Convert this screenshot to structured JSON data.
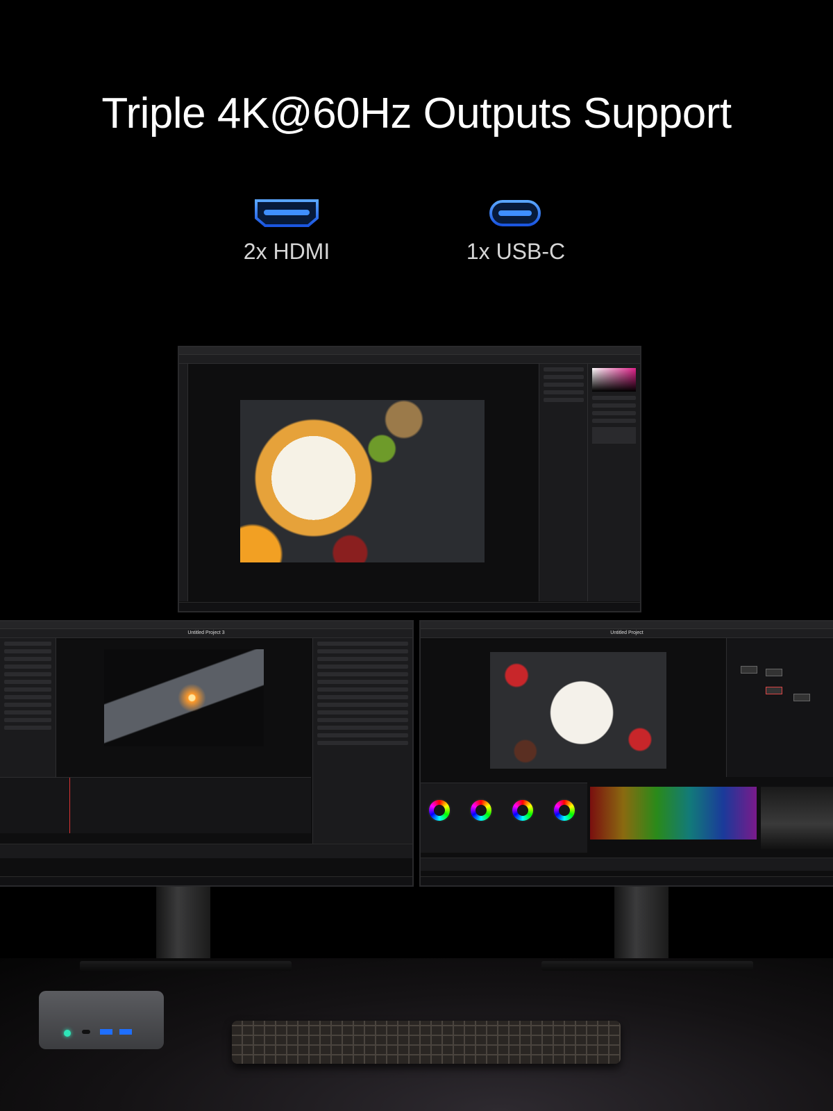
{
  "headline": "Triple 4K@60Hz Outputs Support",
  "ports": [
    {
      "icon": "hdmi-port-icon",
      "label": "2x HDMI"
    },
    {
      "icon": "usb-c-port-icon",
      "label": "1x USB-C"
    }
  ],
  "colors": {
    "accent": "#2f7dff",
    "background": "#000000",
    "text": "#ffffff"
  },
  "monitors": {
    "left_title": "Untitled Project 3",
    "right_title": "Untitled Project"
  }
}
